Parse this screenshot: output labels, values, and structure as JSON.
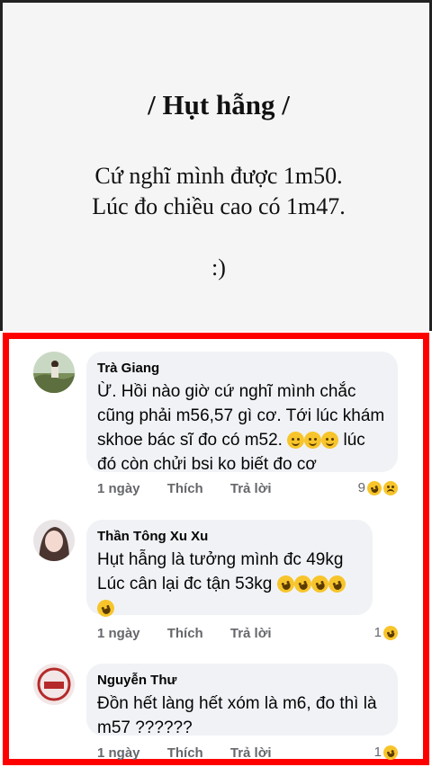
{
  "post": {
    "title": "/ Hụt hẫng /",
    "line1": "Cứ nghĩ mình được 1m50.",
    "line2": "Lúc đo chiều cao có 1m47.",
    "smiley": ":)"
  },
  "comments": [
    {
      "author": "Trà Giang",
      "lines": [
        "Ừ. Hồi nào giờ cứ nghĩ mình chắc",
        "cũng phải m56,57 gì cơ. Tới lúc khám",
        "skhoe bác sĩ đo có m52.",
        "đó còn chửi bsi ko biết đo cơ"
      ],
      "inline_tail": "lúc",
      "time": "1 ngày",
      "like": "Thích",
      "reply": "Trả lời",
      "reaction_count": "9",
      "reaction_icons": [
        "laugh-emoji-icon",
        "sad-emoji-icon"
      ]
    },
    {
      "author": "Thần Tông Xu Xu",
      "lines": [
        "Hụt hẫng là tưởng mình đc 49kg",
        "Lúc cân lại đc tận 53kg"
      ],
      "time": "1 ngày",
      "like": "Thích",
      "reply": "Trả lời",
      "reaction_count": "1",
      "reaction_icons": [
        "laugh-emoji-icon"
      ]
    },
    {
      "author": "Nguyễn Thư",
      "lines": [
        "Đồn hết làng hết xóm là m6, đo thì là",
        "m57 ??????"
      ],
      "time": "1 ngày",
      "like": "Thích",
      "reply": "Trả lời",
      "reaction_count": "1",
      "reaction_icons": [
        "laugh-emoji-icon"
      ]
    }
  ],
  "colors": {
    "highlight": "#ff0000",
    "bubble": "#f0f2f5",
    "meta_text": "#65676b"
  }
}
